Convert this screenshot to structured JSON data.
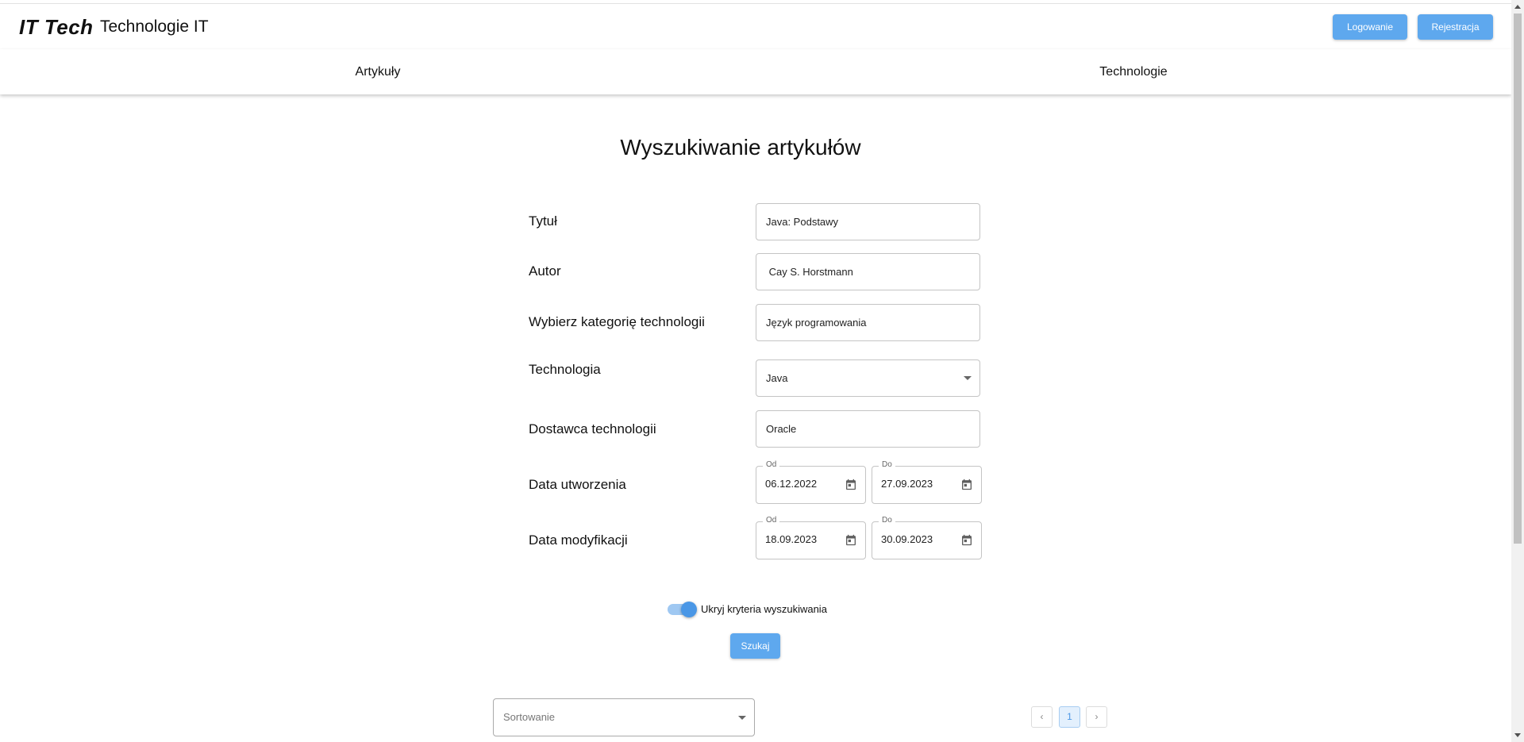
{
  "header": {
    "logo": "IT Tech",
    "subtitle": "Technologie IT",
    "login_label": "Logowanie",
    "register_label": "Rejestracja"
  },
  "nav": {
    "articles": "Artykuły",
    "technologies": "Technologie"
  },
  "page_title": "Wyszukiwanie artykułów",
  "form": {
    "title_label": "Tytuł",
    "title_value": "Java: Podstawy",
    "author_label": "Autor",
    "author_value": " Cay S. Horstmann",
    "category_label": "Wybierz kategorię technologii",
    "category_value": "Język programowania",
    "technology_label": "Technologia",
    "technology_value": "Java",
    "vendor_label": "Dostawca technologii",
    "vendor_value": "Oracle",
    "created_label": "Data utworzenia",
    "created_from_legend": "Od",
    "created_from": "06.12.2022",
    "created_to_legend": "Do",
    "created_to": "27.09.2023",
    "modified_label": "Data modyfikacji",
    "modified_from_legend": "Od",
    "modified_from": "18.09.2023",
    "modified_to_legend": "Do",
    "modified_to": "30.09.2023"
  },
  "toggle": {
    "label": "Ukryj kryteria wyszukiwania",
    "checked": true
  },
  "search_button": "Szukaj",
  "sort": {
    "placeholder": "Sortowanie"
  },
  "pagination": {
    "prev": "‹",
    "current_page": "1",
    "next": "›"
  },
  "colors": {
    "accent": "#5ea8ee",
    "toggle_track": "#9fc8f2",
    "toggle_thumb": "#4a97e6"
  }
}
